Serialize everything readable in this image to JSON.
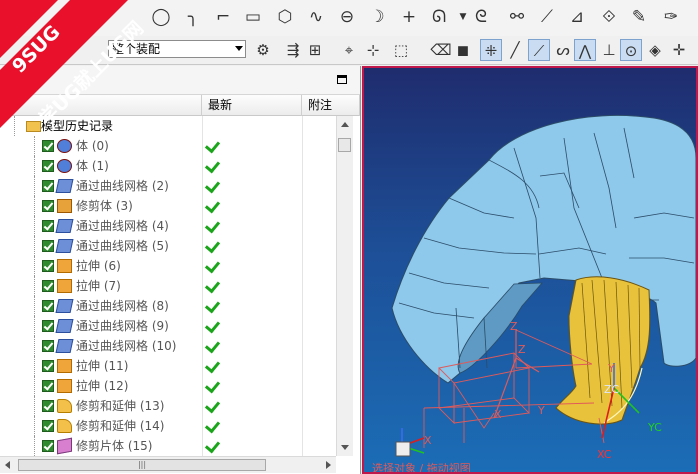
{
  "watermark": {
    "line1": "9SUG",
    "line2": "学UG就上UG网"
  },
  "toolbar2": {
    "assembly_filter": "整个装配"
  },
  "navigator": {
    "columns": [
      "",
      "最新",
      "附注"
    ],
    "root": "模型历史记录",
    "features": [
      {
        "label": "体 (0)",
        "icon": "body-feature-icon",
        "kind": "body"
      },
      {
        "label": "体 (1)",
        "icon": "body-feature-icon",
        "kind": "body"
      },
      {
        "label": "通过曲线网格 (2)",
        "icon": "through-curve-mesh-icon",
        "kind": "mesh"
      },
      {
        "label": "修剪体 (3)",
        "icon": "trim-body-icon",
        "kind": "trimbody"
      },
      {
        "label": "通过曲线网格 (4)",
        "icon": "through-curve-mesh-icon",
        "kind": "mesh"
      },
      {
        "label": "通过曲线网格 (5)",
        "icon": "through-curve-mesh-icon",
        "kind": "mesh"
      },
      {
        "label": "拉伸 (6)",
        "icon": "extrude-icon",
        "kind": "ext"
      },
      {
        "label": "拉伸 (7)",
        "icon": "extrude-icon",
        "kind": "ext"
      },
      {
        "label": "通过曲线网格 (8)",
        "icon": "through-curve-mesh-icon",
        "kind": "mesh"
      },
      {
        "label": "通过曲线网格 (9)",
        "icon": "through-curve-mesh-icon",
        "kind": "mesh"
      },
      {
        "label": "通过曲线网格 (10)",
        "icon": "through-curve-mesh-icon",
        "kind": "mesh"
      },
      {
        "label": "拉伸 (11)",
        "icon": "extrude-icon",
        "kind": "ext"
      },
      {
        "label": "拉伸 (12)",
        "icon": "extrude-icon",
        "kind": "ext"
      },
      {
        "label": "修剪和延伸 (13)",
        "icon": "trim-extend-icon",
        "kind": "trim"
      },
      {
        "label": "修剪和延伸 (14)",
        "icon": "trim-extend-icon",
        "kind": "trim"
      },
      {
        "label": "修剪片体 (15)",
        "icon": "trim-sheet-icon",
        "kind": "sheet"
      }
    ]
  },
  "viewport": {
    "axis_labels": {
      "z1": "Z",
      "y1": "Y",
      "x1": "X",
      "z2": "Z",
      "y2": "Y",
      "x2": "X",
      "zc": "ZC",
      "yc": "YC",
      "xc": "XC"
    },
    "bottom_hint": "选择对象 / 拖动视图"
  },
  "colors": {
    "accent_check": "#1aa51a",
    "viewport_border": "#c0184a",
    "part_blue": "#8ec8ea",
    "part_yellow": "#e8c23a",
    "watermark_red": "#e8102a"
  }
}
